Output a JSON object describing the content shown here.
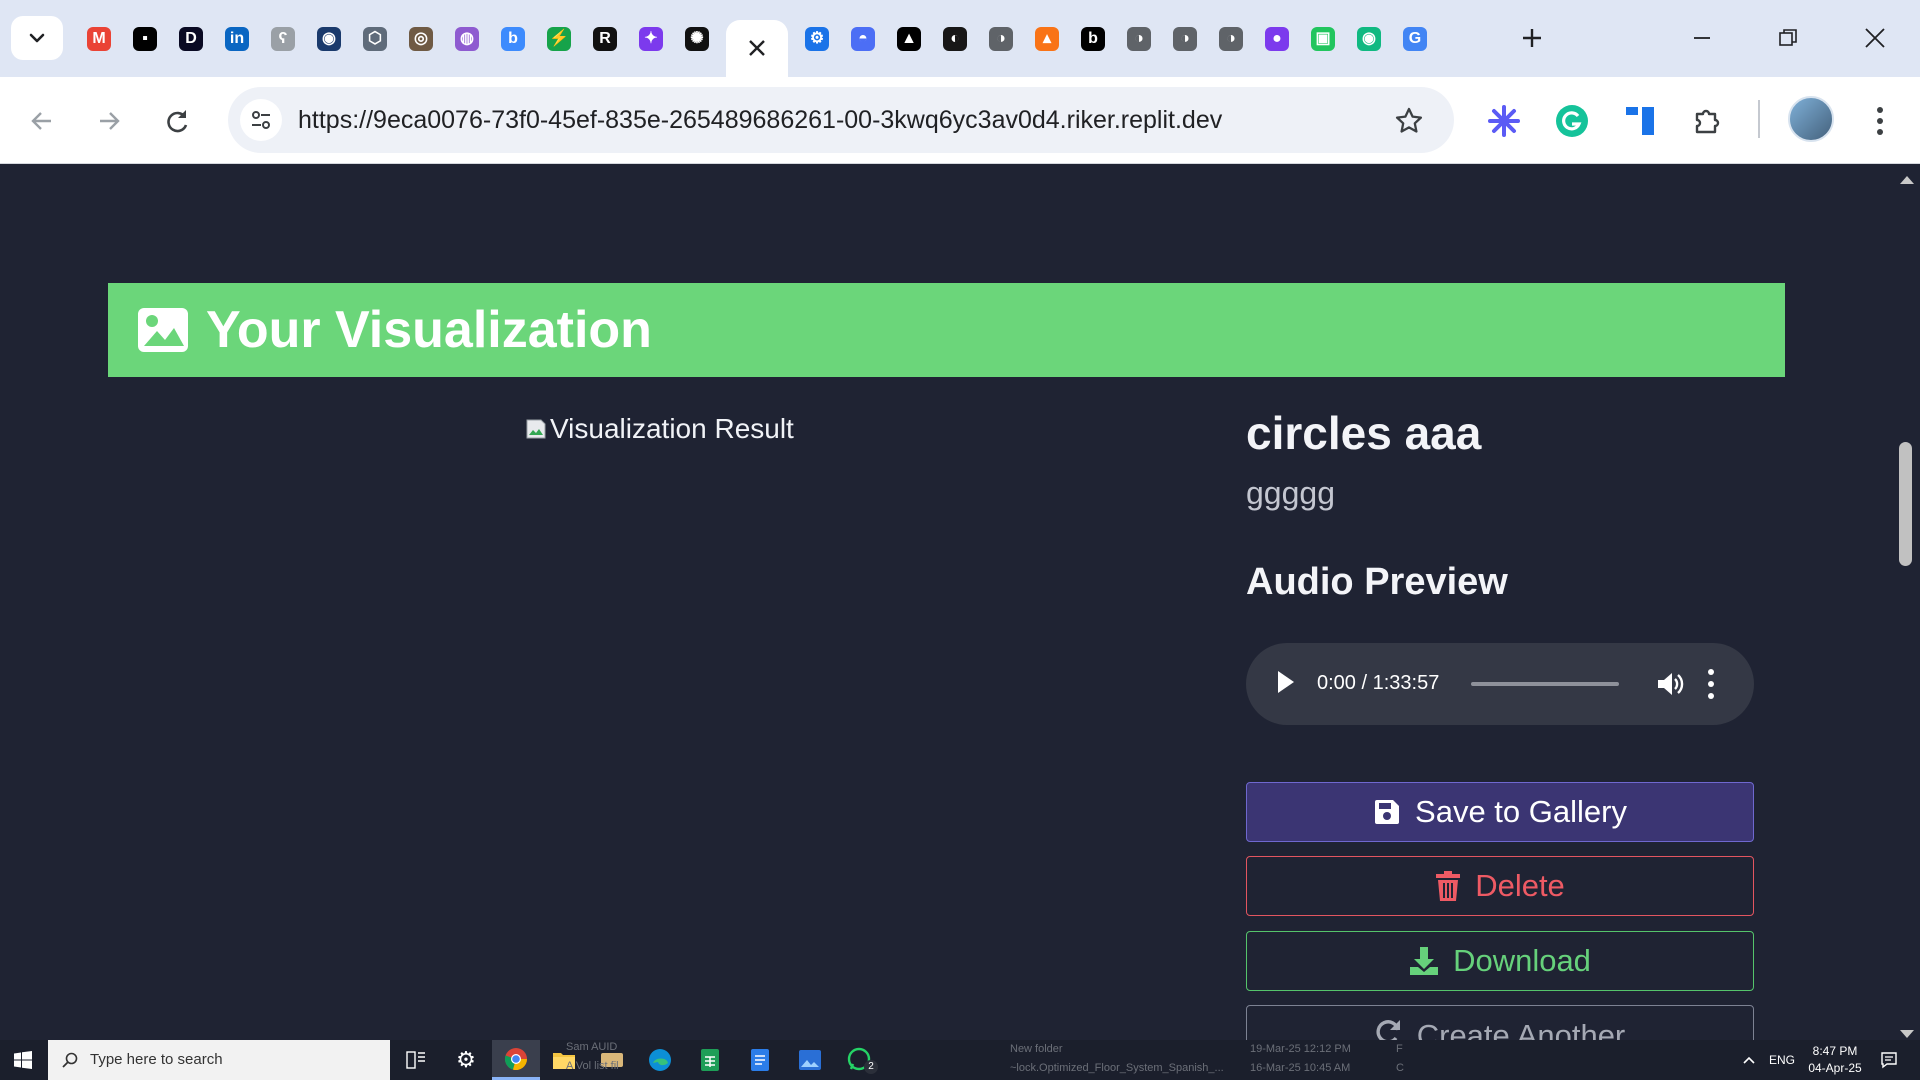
{
  "browser": {
    "address_url": "https://9eca0076-73f0-45ef-835e-265489686261-00-3kwq6yc3av0d4.riker.replit.dev",
    "tabs": [
      {
        "icon": "gmail-icon",
        "color": "#ea4335",
        "glyph": "M"
      },
      {
        "icon": "app-icon",
        "color": "#000000",
        "glyph": "▪"
      },
      {
        "icon": "dribbble-d-icon",
        "color": "#0a0a23",
        "glyph": "D"
      },
      {
        "icon": "linkedin-icon",
        "color": "#0a66c2",
        "glyph": "in"
      },
      {
        "icon": "hook-icon",
        "color": "#9aa0a6",
        "glyph": "ʕ"
      },
      {
        "icon": "circle-app-icon",
        "color": "#1a3a6c",
        "glyph": "◉"
      },
      {
        "icon": "hex-app-icon",
        "color": "#5f6b7a",
        "glyph": "⬡"
      },
      {
        "icon": "owl-icon",
        "color": "#6f5a44",
        "glyph": "◎"
      },
      {
        "icon": "orb-icon",
        "color": "#8e5bd0",
        "glyph": "◍"
      },
      {
        "icon": "b-app-icon",
        "color": "#3d8bfd",
        "glyph": "b"
      },
      {
        "icon": "bolt-icon",
        "color": "#16a34a",
        "glyph": "⚡"
      },
      {
        "icon": "r-app-icon",
        "color": "#111111",
        "glyph": "R"
      },
      {
        "icon": "star-app-icon",
        "color": "#7c3aed",
        "glyph": "✦"
      },
      {
        "icon": "openai-icon",
        "color": "#111111",
        "glyph": "✺"
      }
    ],
    "tabs_after": [
      {
        "icon": "gear-tab-icon",
        "color": "#1a73e8",
        "glyph": "⚙"
      },
      {
        "icon": "whale-icon",
        "color": "#4c6ef5",
        "glyph": "◓"
      },
      {
        "icon": "triangle-icon",
        "color": "#000000",
        "glyph": "▲"
      },
      {
        "icon": "github-icon",
        "color": "#181717",
        "glyph": "◐"
      },
      {
        "icon": "globe-icon",
        "color": "#5f6368",
        "glyph": "◑"
      },
      {
        "icon": "flame-icon",
        "color": "#f97316",
        "glyph": "▴"
      },
      {
        "icon": "b-dark-icon",
        "color": "#000000",
        "glyph": "b"
      },
      {
        "icon": "globe-icon",
        "color": "#5f6368",
        "glyph": "◑"
      },
      {
        "icon": "globe-icon",
        "color": "#5f6368",
        "glyph": "◑"
      },
      {
        "icon": "globe-icon",
        "color": "#5f6368",
        "glyph": "◑"
      },
      {
        "icon": "purple-orb-icon",
        "color": "#7c3aed",
        "glyph": "●"
      },
      {
        "icon": "green-square-icon",
        "color": "#22c55e",
        "glyph": "▣"
      },
      {
        "icon": "green-ring-icon",
        "color": "#10b981",
        "glyph": "◉"
      },
      {
        "icon": "google-icon",
        "color": "#4285f4",
        "glyph": "G"
      }
    ]
  },
  "page": {
    "banner_title": "Your Visualization",
    "image_alt": "Visualization Result",
    "title": "circles aaa",
    "description": "ggggg",
    "audio_heading": "Audio Preview",
    "audio_time": "0:00 / 1:33:57",
    "buttons": {
      "save": "Save to Gallery",
      "delete": "Delete",
      "download": "Download",
      "create": "Create Another"
    }
  },
  "taskbar": {
    "search_placeholder": "Type here to search",
    "ghost_1": "Sam AUID",
    "ghost_2": "A Vol         list fil",
    "ghost_3": "New folder",
    "ghost_4": "~lock.Optimized_Floor_System_Spanish_...",
    "ghost_5": "19-Mar-25 12:12 PM",
    "ghost_6": "16-Mar-25 10:45 AM",
    "ghost_7": "F",
    "ghost_8": "C",
    "language": "ENG",
    "time": "8:47 PM",
    "date": "04-Apr-25",
    "whatsapp_badge": "2"
  },
  "colors": {
    "page_bg": "#1f2333",
    "banner_bg": "#6bd67a",
    "save_bg": "#3b3573",
    "delete": "#ee5a64",
    "download": "#66d17b"
  }
}
